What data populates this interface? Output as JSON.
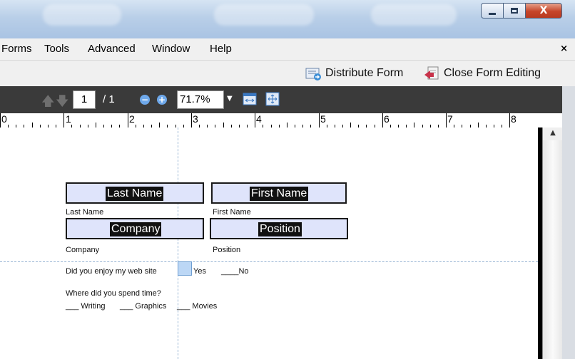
{
  "titlebar": {
    "close_glyph": "X"
  },
  "menu": {
    "items": [
      "Forms",
      "Tools",
      "Advanced",
      "Window",
      "Help"
    ],
    "close_glyph": "×"
  },
  "form_toolbar": {
    "distribute_label": "Distribute Form",
    "close_editing_label": "Close Form Editing"
  },
  "nav": {
    "current_page": "1",
    "total_pages": "/ 1",
    "zoom": "71.7%"
  },
  "ruler": {
    "numbers": [
      "0",
      "1",
      "2",
      "3",
      "4",
      "5",
      "6",
      "7",
      "8"
    ]
  },
  "form": {
    "last_name_field": "Last Name",
    "first_name_field": "First Name",
    "company_field": "Company",
    "position_field": "Position",
    "last_name_caption": "Last Name",
    "first_name_caption": "First Name",
    "company_caption": "Company",
    "position_caption": "Position",
    "enjoy_question": "Did you enjoy my web site",
    "yes_label": "Yes",
    "no_label": "____No",
    "spend_question": "Where did you spend time?",
    "writing_option": "___ Writing",
    "graphics_option": "___ Graphics",
    "movies_option": "___ Movies"
  },
  "colors": {
    "field_fill": "#dfe4fb",
    "toolbar_dark": "#3a3a3a",
    "close_button": "#c6452a"
  }
}
